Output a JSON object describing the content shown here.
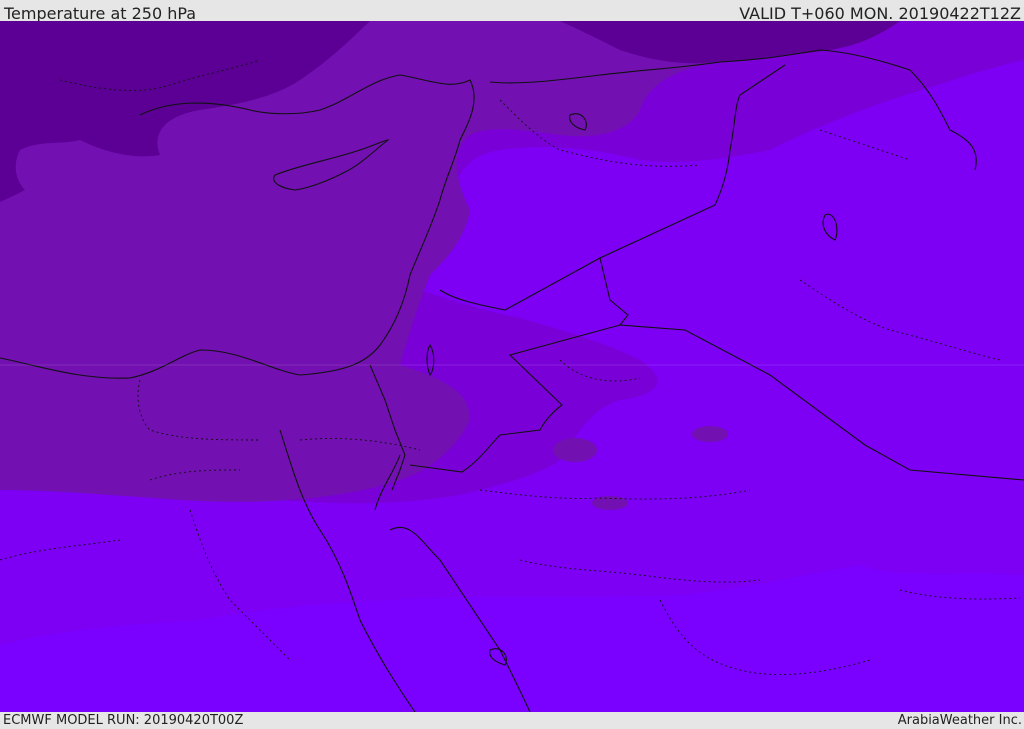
{
  "header": {
    "title": "Temperature at 250 hPa",
    "valid_time": "VALID T+060 MON. 20190422T12Z"
  },
  "footer": {
    "model_run": "ECMWF MODEL RUN: 20190420T00Z",
    "credit": "ArabiaWeather Inc."
  },
  "colors": {
    "band_coldest": "#5c0095",
    "band_cold": "#7210b2",
    "band_mid": "#7a00d8",
    "band_warm": "#7d00f5",
    "band_warmest": "#7a00ff",
    "coastline": "#111111",
    "borders": "#111111"
  }
}
